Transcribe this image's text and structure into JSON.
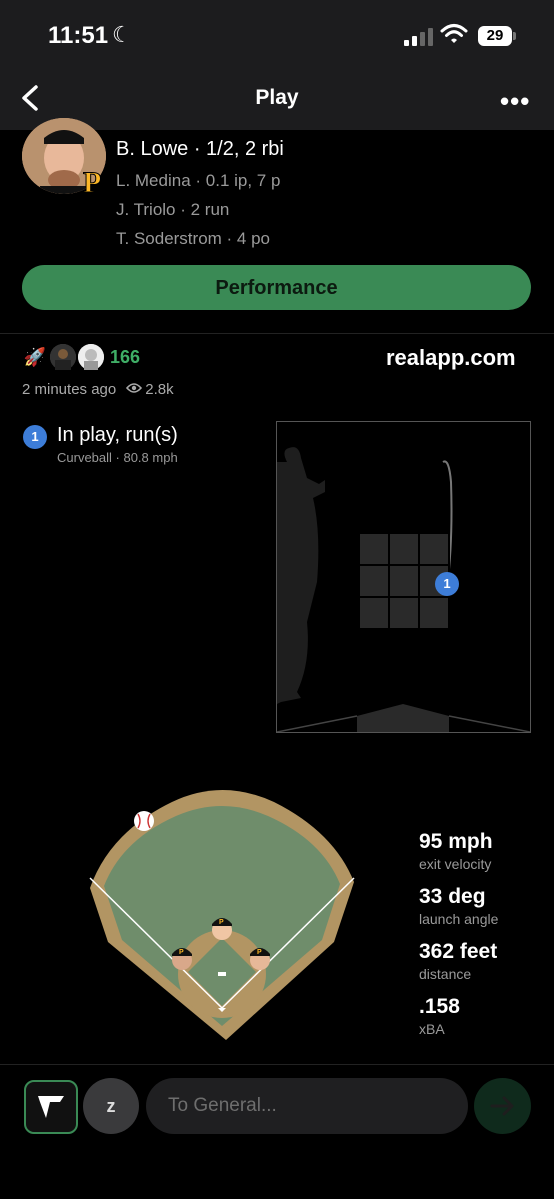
{
  "status_bar": {
    "time": "11:51",
    "battery": "29"
  },
  "nav": {
    "title": "Play"
  },
  "game_summary": {
    "lines": [
      "B. Lowe · 1/2, 2 rbi",
      "L. Medina · 0.1 ip, 7 p",
      "J. Triolo · 2 run",
      "T. Soderstrom · 4 po"
    ]
  },
  "performance_label": "Performance",
  "post": {
    "reaction_count": "166",
    "site": "realapp.com",
    "time_ago": "2 minutes ago",
    "views": "2.8k"
  },
  "pitch": {
    "number": "1",
    "title": "In play, run(s)",
    "subtitle": "Curveball · 80.8 mph"
  },
  "hit_stats": [
    {
      "value": "95 mph",
      "label": "exit velocity"
    },
    {
      "value": "33 deg",
      "label": "launch angle"
    },
    {
      "value": "362 feet",
      "label": "distance"
    },
    {
      "value": ".158",
      "label": "xBA"
    }
  ],
  "composer": {
    "avatar_letter": "z",
    "placeholder": "To General..."
  },
  "colors": {
    "accent_green": "#3a8a55",
    "badge_blue": "#3d7dd8",
    "pirates_gold": "#fdb827"
  }
}
